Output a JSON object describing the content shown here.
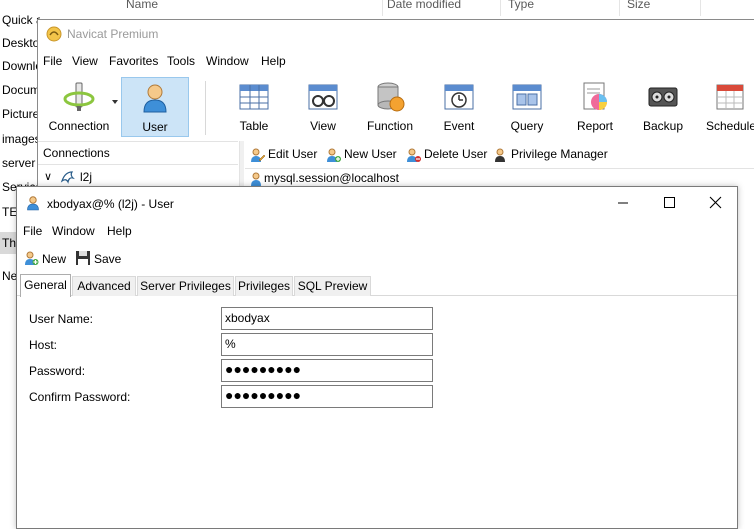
{
  "explorer": {
    "columns": [
      "Name",
      "Date modified",
      "Type",
      "Size"
    ],
    "nav_items": [
      "Quick access",
      "Desktop",
      "Downloads",
      "Documents",
      "Pictures",
      "images",
      "server",
      "Services",
      "TEST",
      "This PC",
      "Network"
    ]
  },
  "navicat": {
    "title": "Navicat Premium",
    "menu": [
      "File",
      "View",
      "Favorites",
      "Tools",
      "Window",
      "Help"
    ],
    "toolbar": [
      {
        "label": "Connection",
        "icon": "connection-icon"
      },
      {
        "label": "User",
        "icon": "user-icon"
      },
      {
        "label": "Table",
        "icon": "table-icon"
      },
      {
        "label": "View",
        "icon": "view-icon"
      },
      {
        "label": "Function",
        "icon": "function-icon"
      },
      {
        "label": "Event",
        "icon": "event-icon"
      },
      {
        "label": "Query",
        "icon": "query-icon"
      },
      {
        "label": "Report",
        "icon": "report-icon"
      },
      {
        "label": "Backup",
        "icon": "backup-icon"
      },
      {
        "label": "Schedule",
        "icon": "schedule-icon"
      }
    ],
    "connections_header": "Connections",
    "connection_name": "l2j",
    "object_toolbar": [
      "Edit User",
      "New User",
      "Delete User",
      "Privilege Manager"
    ],
    "object_item": "mysql.session@localhost"
  },
  "user_window": {
    "title": "xbodyax@% (l2j) - User",
    "menu": [
      "File",
      "Window",
      "Help"
    ],
    "toolbar": {
      "new_label": "New",
      "save_label": "Save"
    },
    "tabs": [
      "General",
      "Advanced",
      "Server Privileges",
      "Privileges",
      "SQL Preview"
    ],
    "form": {
      "user_name_label": "User Name:",
      "user_name_value": "xbodyax",
      "host_label": "Host:",
      "host_value": "%",
      "password_label": "Password:",
      "password_value": "●●●●●●●●●",
      "confirm_label": "Confirm Password:",
      "confirm_value": "●●●●●●●●●"
    }
  },
  "colors": {
    "active_toolbar_bg": "#cce4f7",
    "active_toolbar_border": "#99c8ed"
  }
}
